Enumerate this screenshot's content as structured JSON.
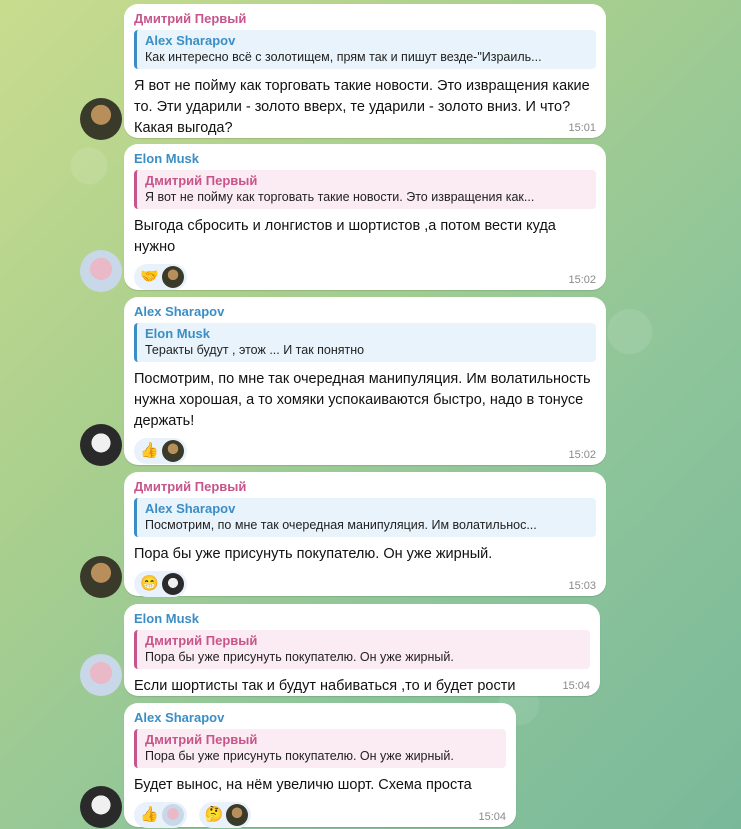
{
  "messages": [
    {
      "sender": "Дмитрий Первый",
      "reply_name": "Alex Sharapov",
      "reply_text": "Как интересно всё с золотищем, прям так и пишут везде-\"Израиль...",
      "text": "Я вот не пойму как торговать такие новости. Это извращения какие то. Эти ударили - золото вверх, те ударили - золото вниз. И что? Какая выгода?",
      "time": "15:01"
    },
    {
      "sender": "Elon Musk",
      "reply_name": "Дмитрий Первый",
      "reply_text": "Я вот не пойму как торговать такие новости. Это извращения как...",
      "text": "Выгода сбросить и лонгистов и шортистов ,а потом вести куда нужно",
      "reactions": [
        {
          "emoji": "🤝",
          "icon": "handshake-icon"
        }
      ],
      "time": "15:02"
    },
    {
      "sender": "Alex Sharapov",
      "reply_name": "Elon Musk",
      "reply_text": "Теракты будут , этож ... И так понятно",
      "text": "Посмотрим, по мне так очередная манипуляция. Им волатильность нужна хорошая, а то хомяки успокаиваются быстро, надо в тонусе держать!",
      "reactions": [
        {
          "emoji": "👍",
          "icon": "thumbs-up-icon"
        }
      ],
      "time": "15:02"
    },
    {
      "sender": "Дмитрий Первый",
      "reply_name": "Alex Sharapov",
      "reply_text": "Посмотрим, по мне так очередная манипуляция. Им волатильнос...",
      "text": "Пора бы уже присунуть покупателю. Он уже жирный.",
      "reactions": [
        {
          "emoji": "😁",
          "icon": "grin-icon"
        }
      ],
      "time": "15:03"
    },
    {
      "sender": "Elon Musk",
      "reply_name": "Дмитрий Первый",
      "reply_text": "Пора бы уже присунуть покупателю. Он уже жирный.",
      "text": "Если шортисты так и будут набиваться ,то и будет рости",
      "time": "15:04"
    },
    {
      "sender": "Alex Sharapov",
      "reply_name": "Дмитрий Первый",
      "reply_text": "Пора бы уже присунуть покупателю. Он уже жирный.",
      "text": "Будет вынос, на нём увеличю шорт. Схема проста",
      "reactions": [
        {
          "emoji": "👍",
          "icon": "thumbs-up-icon"
        },
        {
          "emoji": "🤔",
          "icon": "thinking-icon"
        }
      ],
      "time": "15:04"
    }
  ]
}
